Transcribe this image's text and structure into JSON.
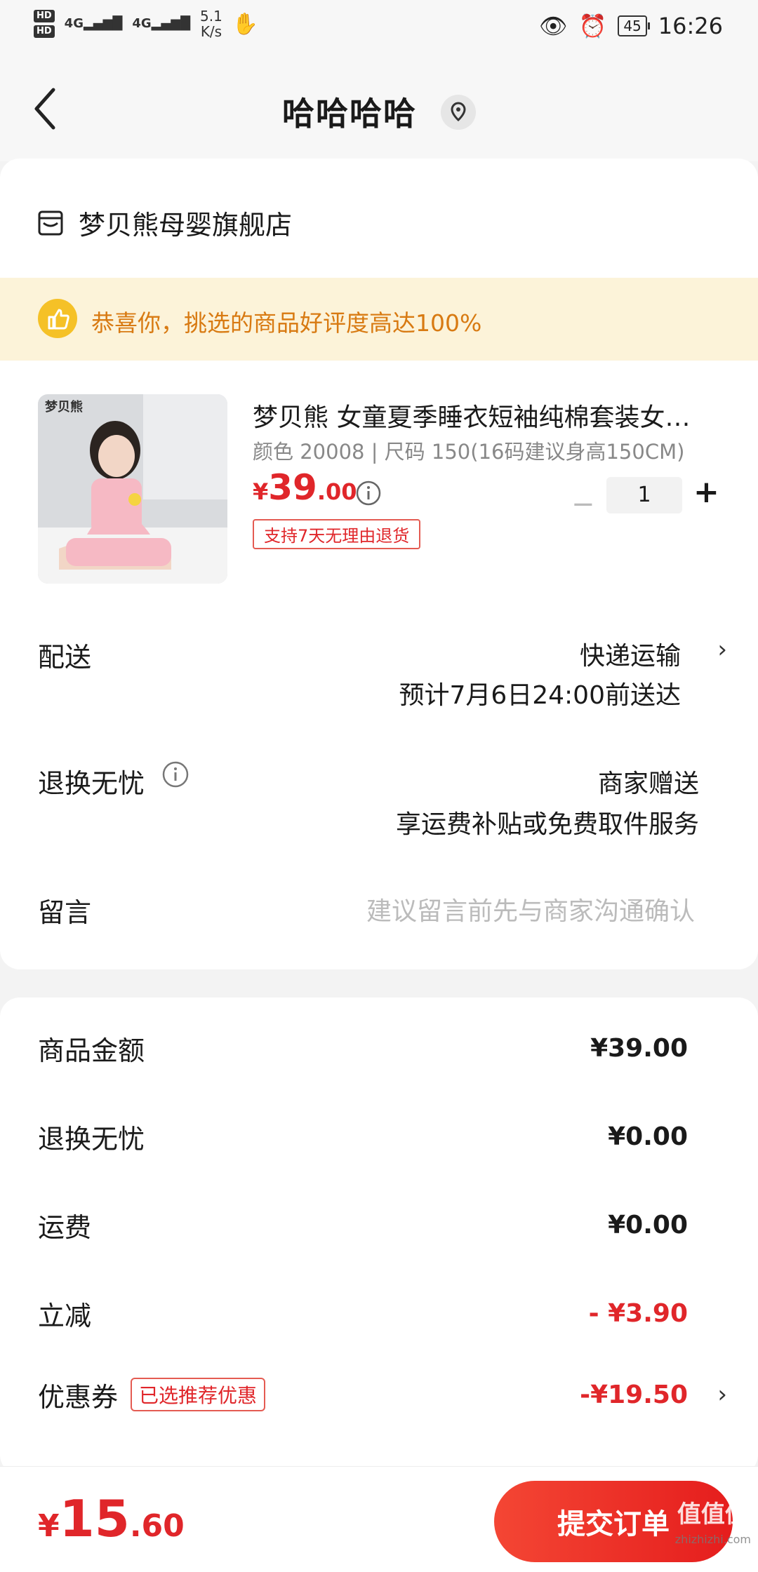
{
  "status_bar": {
    "hd1": "HD",
    "hd2": "HD",
    "net1": "4G",
    "net2": "4G",
    "speed_value": "5.1",
    "speed_unit": "K/s",
    "battery": "45",
    "time": "16:26"
  },
  "nav": {
    "title": "哈哈哈哈"
  },
  "store": {
    "name": "梦贝熊母婴旗舰店"
  },
  "banner": {
    "text": "恭喜你，挑选的商品好评度高达100%"
  },
  "product": {
    "brand_tag": "梦贝熊",
    "title": "梦贝熊 女童夏季睡衣短袖纯棉套装女…",
    "spec": "颜色 20008 | 尺码 150(16码建议身高150CM)",
    "price_currency": "¥",
    "price_int": "39",
    "price_dec": ".00",
    "return_badge": "支持7天无理由退货",
    "quantity": "1",
    "minus": "−",
    "plus": "+"
  },
  "delivery": {
    "label": "配送",
    "method": "快递运输",
    "eta": "预计7月6日24:00前送达"
  },
  "return_service": {
    "label": "退换无忧",
    "value": "商家赠送",
    "desc": "享运费补贴或免费取件服务"
  },
  "message": {
    "label": "留言",
    "placeholder": "建议留言前先与商家沟通确认"
  },
  "summary": [
    {
      "label": "商品金额",
      "value": "¥39.00"
    },
    {
      "label": "退换无忧",
      "value": "¥0.00"
    },
    {
      "label": "运费",
      "value": "¥0.00"
    },
    {
      "label": "立减",
      "value": "- ¥3.90"
    },
    {
      "label": "优惠券",
      "badge": "已选推荐优惠",
      "value": "-¥19.50"
    }
  ],
  "footer": {
    "total_currency": "¥",
    "total_int": "15",
    "total_dec": ".60",
    "submit_label": "提交订单",
    "watermark": "值值值",
    "watermark_url": "zhizhizhi.com"
  },
  "colors": {
    "accent_red": "#e0262a",
    "banner_bg": "#fcf3d9",
    "banner_text": "#d87a12"
  }
}
